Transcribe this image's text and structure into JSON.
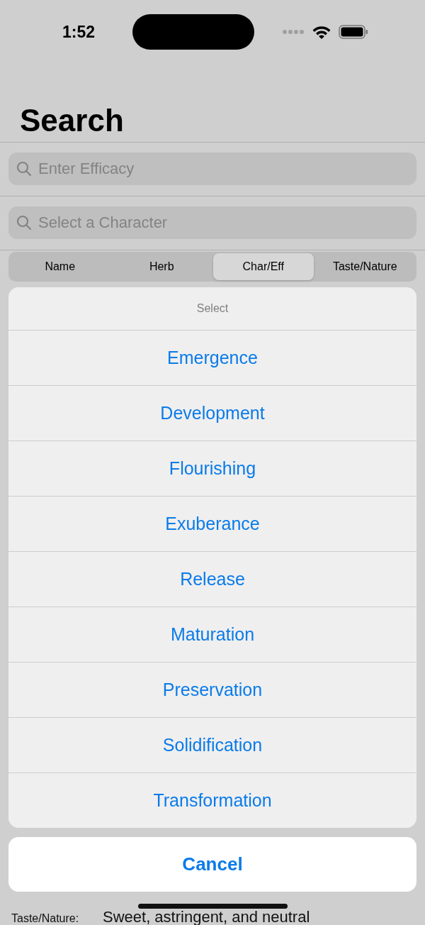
{
  "status_bar": {
    "time": "1:52"
  },
  "title": "Search",
  "search_fields": [
    {
      "placeholder": "Enter Efficacy"
    },
    {
      "placeholder": "Select a Character"
    }
  ],
  "tabs": [
    {
      "label": "Name",
      "selected": false
    },
    {
      "label": "Herb",
      "selected": false
    },
    {
      "label": "Char/Eff",
      "selected": true
    },
    {
      "label": "Taste/Nature",
      "selected": false
    }
  ],
  "result_rows": [
    {
      "label": "Taste/Nature:",
      "value": "Sweet, astringent, and neutral"
    }
  ],
  "action_sheet": {
    "title": "Select",
    "options": [
      "Emergence",
      "Development",
      "Flourishing",
      "Exuberance",
      "Release",
      "Maturation",
      "Preservation",
      "Solidification",
      "Transformation"
    ],
    "cancel": "Cancel"
  }
}
